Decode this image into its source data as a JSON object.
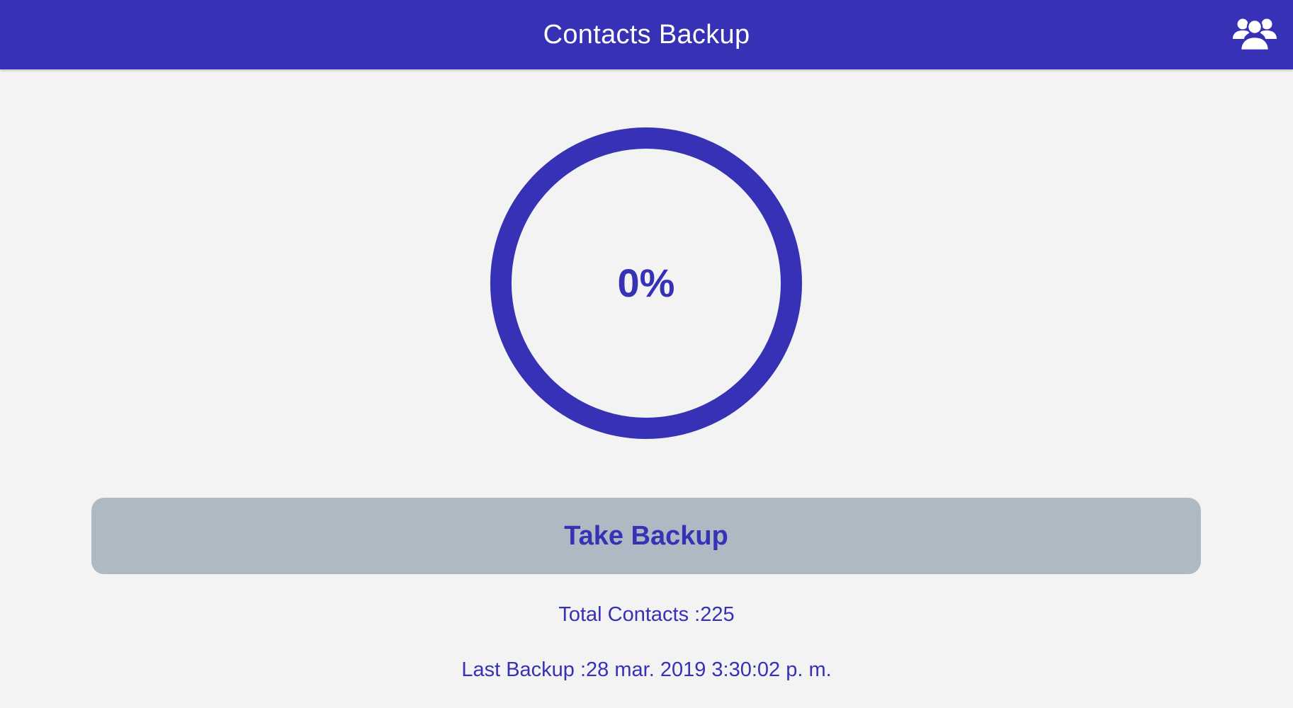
{
  "app_bar": {
    "title": "Contacts Backup",
    "action_icon": "contacts-group-icon"
  },
  "progress": {
    "label": "0%",
    "value": 0
  },
  "backup_button": {
    "label": "Take Backup"
  },
  "info": {
    "total_contacts": "Total Contacts :225",
    "last_backup": "Last Backup :28 mar. 2019 3:30:02 p. m."
  },
  "colors": {
    "primary": "#3631b5",
    "background": "#f3f3f4",
    "button_bg": "#adb9c3"
  }
}
